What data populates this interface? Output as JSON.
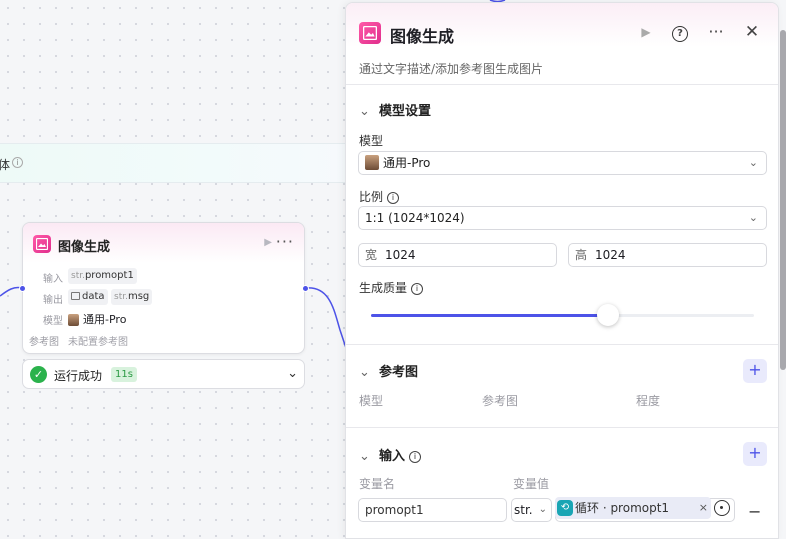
{
  "canvas": {
    "group_title": "体",
    "group_info_icon": "info-icon",
    "node": {
      "title": "图像生成",
      "play_icon": "▶",
      "more_icon": "···",
      "rows": {
        "input_label": "输入",
        "input_type": "str.",
        "input_value": "promopt1",
        "output_label": "输出",
        "output1_value": "data",
        "output2_type": "str.",
        "output2_value": "msg",
        "model_label": "模型",
        "model_value": "通用-Pro",
        "ref_label": "参考图",
        "ref_value": "未配置参考图"
      }
    },
    "status": {
      "text": "运行成功",
      "duration": "11s"
    }
  },
  "panel": {
    "title": "图像生成",
    "description": "通过文字描述/添加参考图生成图片",
    "header_icons": [
      "play-icon",
      "help-icon",
      "more-icon",
      "close-icon"
    ],
    "model_settings": {
      "section_title": "模型设置",
      "model_label": "模型",
      "model_value": "通用-Pro",
      "ratio_label": "比例",
      "ratio_value": "1:1 (1024*1024)",
      "width_prefix": "宽",
      "width_value": "1024",
      "height_prefix": "高",
      "height_value": "1024",
      "quality_label": "生成质量",
      "quality_level": 0.62
    },
    "reference": {
      "section_title": "参考图",
      "columns": [
        "模型",
        "参考图",
        "程度"
      ]
    },
    "inputs": {
      "section_title": "输入",
      "col_name": "变量名",
      "col_value": "变量值",
      "rows": [
        {
          "name": "promopt1",
          "type": "str.",
          "ref_source": "循环",
          "ref_var": "promopt1",
          "ref_text": "循环 · promopt1"
        }
      ]
    }
  },
  "colors": {
    "accent": "#4d53e8",
    "success": "#2bb24c",
    "brand_pink": "#e02d8c"
  }
}
